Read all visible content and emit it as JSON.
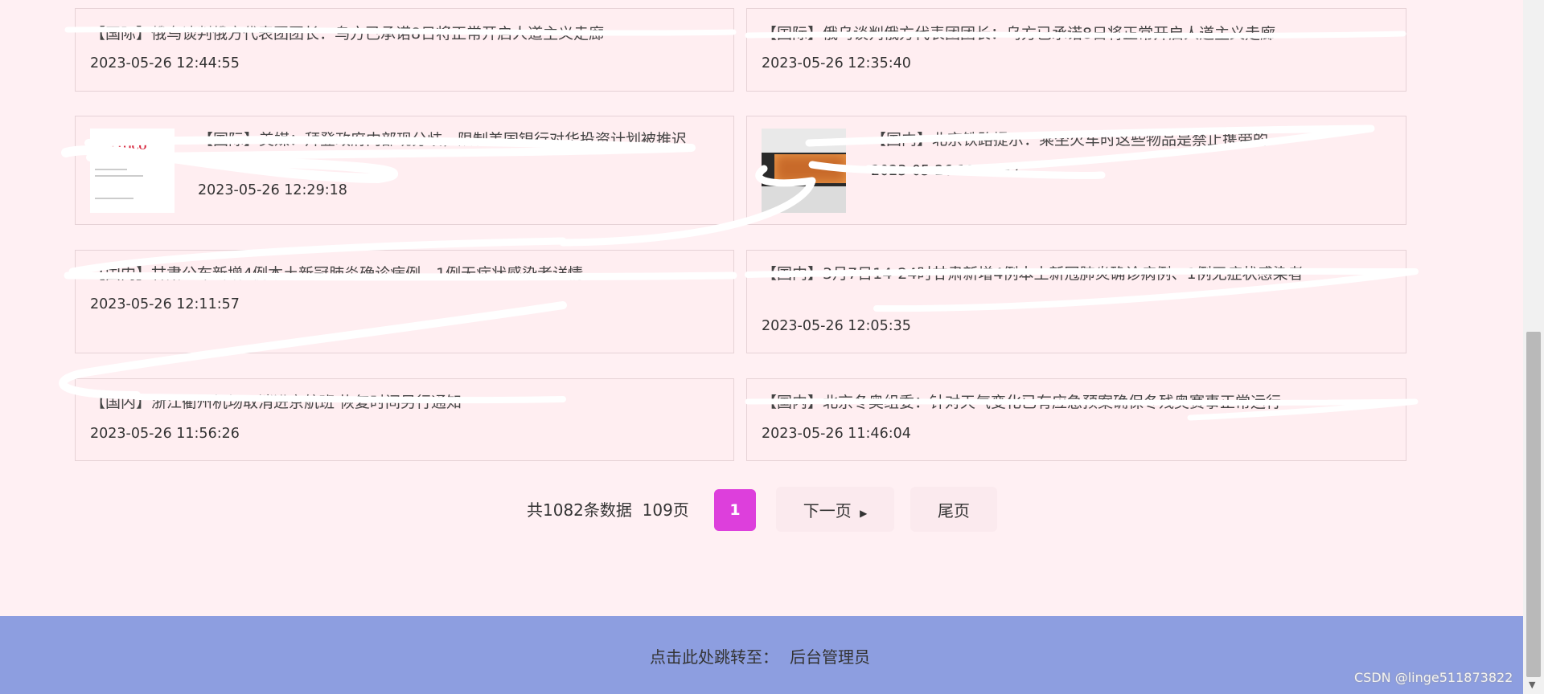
{
  "news": [
    {
      "title": "【国际】俄乌谈判俄方代表团团长：乌方已承诺8日将正常开启人道主义走廊",
      "time": "2023-05-26 12:44:55"
    },
    {
      "title": "【国际】俄乌谈判俄方代表团团长：乌方已承诺8日将正常开启人道主义走廊",
      "time": "2023-05-26 12:35:40"
    },
    {
      "title": "【国际】美媒：拜登政府内部现分歧，限制美国银行对华投资计划被推迟",
      "time": "2023-05-26 12:29:18",
      "thumb_logo": "POLITICO"
    },
    {
      "title": "【国内】北京铁路提示：乘坐火车时这些物品是禁止携带的",
      "time": "2023-05-26 12:24:37"
    },
    {
      "title": "【国内】甘肃公布新增4例本土新冠肺炎确诊病例、1例无症状感染者详情",
      "time": "2023-05-26 12:11:57"
    },
    {
      "title": "【国内】3月7日14-24时甘肃新增4例本土新冠肺炎确诊病例、1例无症状感染者",
      "time": "2023-05-26 12:05:35"
    },
    {
      "title": "【国内】浙江衢州机场取消进京航班 恢复时间另行通知",
      "time": "2023-05-26 11:56:26"
    },
    {
      "title": "【国内】北京冬奥组委：针对天气变化已有应急预案确保冬残奥赛事正常运行",
      "time": "2023-05-26 11:46:04"
    }
  ],
  "pagination": {
    "total_label": "共1082条数据",
    "pages_label": "109页",
    "current_page": "1",
    "next_label": "下一页",
    "next_icon": "caret-right-icon",
    "last_label": "尾页"
  },
  "footer": {
    "jump_label": "点击此处跳转至：",
    "admin_link": "后台管理员"
  },
  "watermark": "CSDN @linge511873822",
  "colors": {
    "page_bg": "#fff0f3",
    "card_border": "#e6d2d6",
    "current_page": "#dd3fdc",
    "footer_bg": "#8d9ee0"
  }
}
